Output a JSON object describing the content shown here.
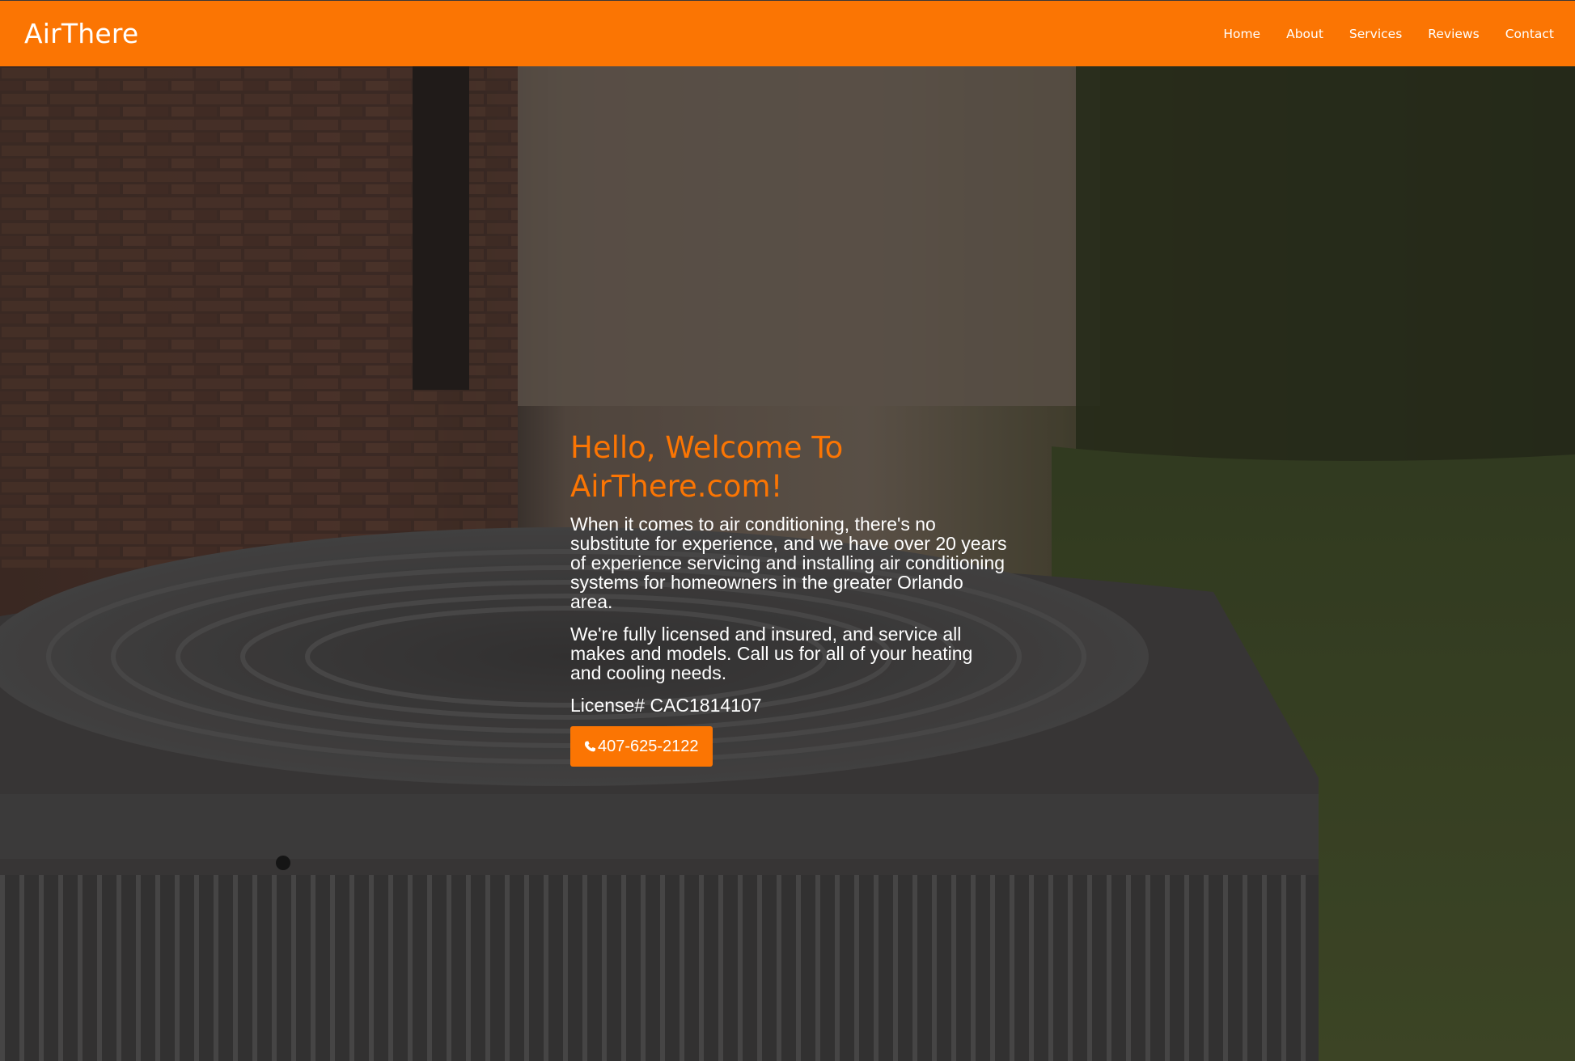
{
  "header": {
    "brand": "AirThere",
    "nav": [
      {
        "label": "Home"
      },
      {
        "label": "About"
      },
      {
        "label": "Services"
      },
      {
        "label": "Reviews"
      },
      {
        "label": "Contact"
      }
    ]
  },
  "hero": {
    "title_line1": "Hello, Welcome To",
    "title_line2": "AirThere.com!",
    "paragraph1": "When it comes to air conditioning, there's no substitute for experience, and we have over 20 years of experience servicing and installing air conditioning systems for homeowners in the greater Orlando area.",
    "paragraph2": "We're fully licensed and insured, and service all makes and models. Call us for all of your heating and cooling needs.",
    "license": "License# CAC1814107",
    "phone": "407-625-2122",
    "phone_icon": "phone-icon"
  },
  "colors": {
    "accent": "#fb7503",
    "text": "#ffffff"
  }
}
